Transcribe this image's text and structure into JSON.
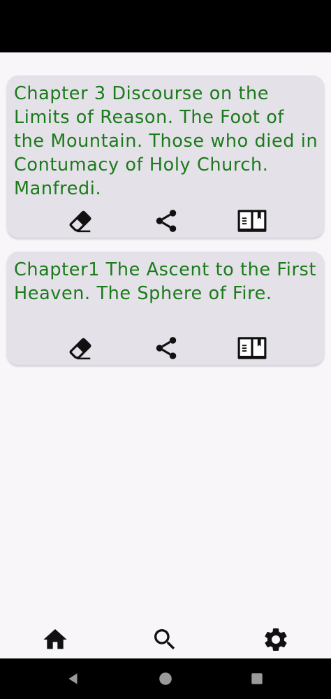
{
  "chapters": [
    {
      "title": "Chapter 3 Discourse on the Limits of Reason. The Foot of the Mountain. Those who died in Contumacy of Holy Church. Manfredi.",
      "actions": [
        "eraser-icon",
        "share-icon",
        "book-open-icon"
      ]
    },
    {
      "title": "Chapter1 The Ascent to the First Heaven. The Sphere of Fire.",
      "actions": [
        "eraser-icon",
        "share-icon",
        "book-open-icon"
      ]
    }
  ],
  "bottom_nav": {
    "items": [
      "home-icon",
      "search-icon",
      "settings-icon"
    ]
  },
  "system_nav": {
    "items": [
      "back-icon",
      "home-circle-icon",
      "recents-icon"
    ]
  },
  "colors": {
    "title_text": "#1b7a1b",
    "card_background": "#e4e1e8",
    "screen_background": "#f8f6f9",
    "system_bars": "#000000"
  }
}
